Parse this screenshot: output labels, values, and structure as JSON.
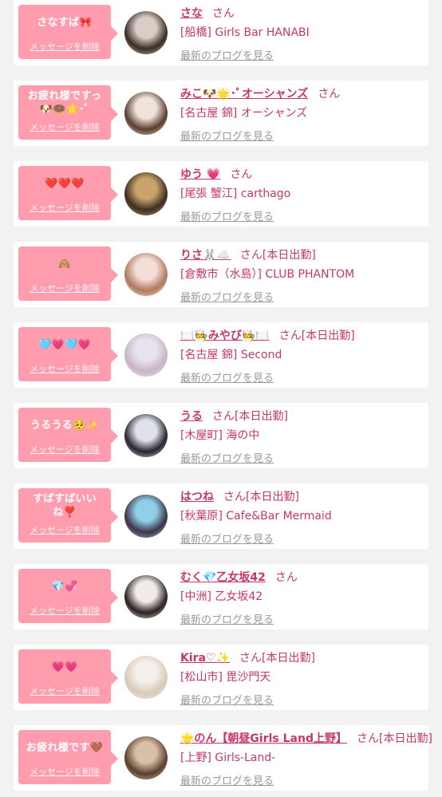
{
  "messages": [
    {
      "message": "さなすば🎀",
      "delete_label": "メッセージを削除",
      "name": "さな",
      "honorific": "さん",
      "status": "",
      "shop": "[船橋] Girls Bar HANABI",
      "blog_link": "最新のブログを見る",
      "avatar_colors": [
        "#d9cdc6",
        "#3a2b25"
      ]
    },
    {
      "message": "お疲れ様ですっ🐶🍩🌟･ﾟ",
      "delete_label": "メッセージを削除",
      "name": "みこ🐶🌟･ﾟオーシャンズ",
      "honorific": "さん",
      "status": "",
      "shop": "[名古屋 錦] オーシャンズ",
      "blog_link": "最新のブログを見る",
      "avatar_colors": [
        "#efe3da",
        "#5a3d30"
      ]
    },
    {
      "message": "❤️❤️❤️",
      "delete_label": "メッセージを削除",
      "name": "ゆう 💗",
      "honorific": "さん",
      "status": "",
      "shop": "[尾張 蟹江] carthago",
      "blog_link": "最新のブログを見る",
      "avatar_colors": [
        "#c9a46a",
        "#3c2e22"
      ]
    },
    {
      "message": "🙈",
      "delete_label": "メッセージを削除",
      "name": "りさ🐰☁️",
      "honorific": "さん",
      "status": "[本日出勤]",
      "shop": "[倉敷市（水島）] CLUB PHANTOM",
      "blog_link": "最新のブログを見る",
      "avatar_colors": [
        "#f3dfd8",
        "#b07a5e"
      ]
    },
    {
      "message": "🩵💗🩵💗",
      "delete_label": "メッセージを削除",
      "name": "🍽️🧑‍🍳みやび🧑‍🍳🍽️",
      "honorific": "さん",
      "status": "[本日出勤]",
      "shop": "[名古屋 錦] Second",
      "blog_link": "最新のブログを見る",
      "avatar_colors": [
        "#e8e4ee",
        "#c9b5c6"
      ]
    },
    {
      "message": "うるうる🥺✨",
      "delete_label": "メッセージを削除",
      "name": "うる",
      "honorific": "さん",
      "status": "[本日出勤]",
      "shop": "[木屋町] 海の中",
      "blog_link": "最新のブログを見る",
      "avatar_colors": [
        "#dfe2ea",
        "#2a2430"
      ]
    },
    {
      "message": "すばすばいいね❣️",
      "delete_label": "メッセージを削除",
      "name": "はつね",
      "honorific": "さん",
      "status": "[本日出勤]",
      "shop": "[秋葉原] Cafe&Bar Mermaid",
      "blog_link": "最新のブログを見る",
      "avatar_colors": [
        "#8fd0e8",
        "#3f3347"
      ]
    },
    {
      "message": "💎💞",
      "delete_label": "メッセージを削除",
      "name": "むく💎乙女坂42",
      "honorific": "さん",
      "status": "",
      "shop": "[中洲] 乙女坂42",
      "blog_link": "最新のブログを見る",
      "avatar_colors": [
        "#f1ece9",
        "#2b2220"
      ]
    },
    {
      "message": "💗💗",
      "delete_label": "メッセージを削除",
      "name": "Kira♡✨",
      "honorific": "さん",
      "status": "[本日出勤]",
      "shop": "[松山市] 毘沙門天",
      "blog_link": "最新のブログを見る",
      "avatar_colors": [
        "#f4efe8",
        "#d9c9b8"
      ]
    },
    {
      "message": "お疲れ様です🤎",
      "delete_label": "メッセージを削除",
      "name": "🌟のん【朝昼Girls Land上野】",
      "honorific": "さん",
      "status": "[本日出勤]",
      "shop": "[上野] Girls-Land-",
      "blog_link": "最新のブログを見る",
      "avatar_colors": [
        "#d8bfa8",
        "#5b4030"
      ]
    }
  ]
}
